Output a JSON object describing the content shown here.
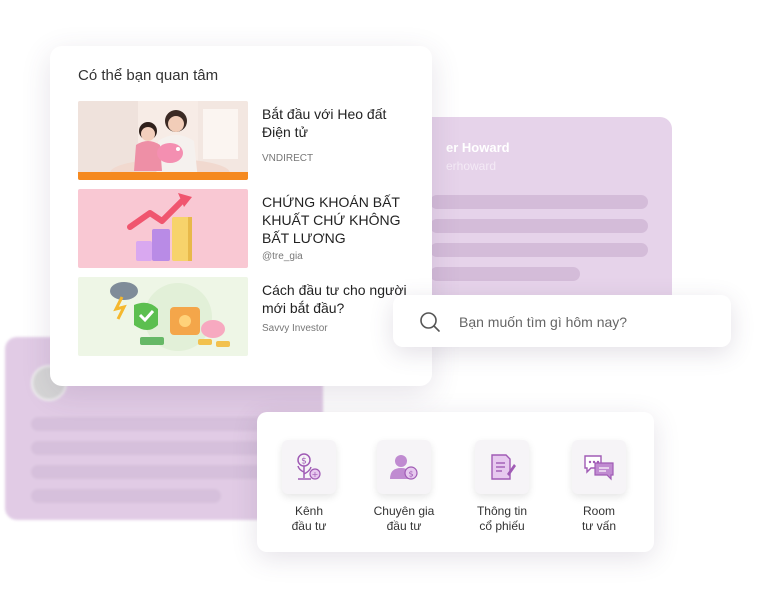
{
  "interest": {
    "title": "Có thể bạn quan tâm",
    "items": [
      {
        "title": "Bắt đầu với Heo đất Điện tử",
        "source": "VNDIRECT"
      },
      {
        "title": "CHỨNG KHOÁN BẤT KHUẤT CHỨ KHÔNG BẤT LƯƠNG",
        "source": "@tre_gia"
      },
      {
        "title": "Cách đầu tư cho người mới bắt đầu?",
        "source": "Savvy Investor"
      }
    ]
  },
  "profile_card": {
    "name": "er Howard",
    "handle": "erhoward"
  },
  "search": {
    "placeholder": "Bạn muốn tìm gì hôm nay?"
  },
  "features": [
    {
      "label": "Kênh\nđầu tư",
      "icon": "money-plant-icon"
    },
    {
      "label": "Chuyên gia\nđầu tư",
      "icon": "expert-icon"
    },
    {
      "label": "Thông tin\ncổ phiếu",
      "icon": "stock-document-icon"
    },
    {
      "label": "Room\ntư vấn",
      "icon": "chat-room-icon"
    }
  ],
  "colors": {
    "accent": "#a05bb5",
    "card_bg": "#e6d3ea"
  }
}
